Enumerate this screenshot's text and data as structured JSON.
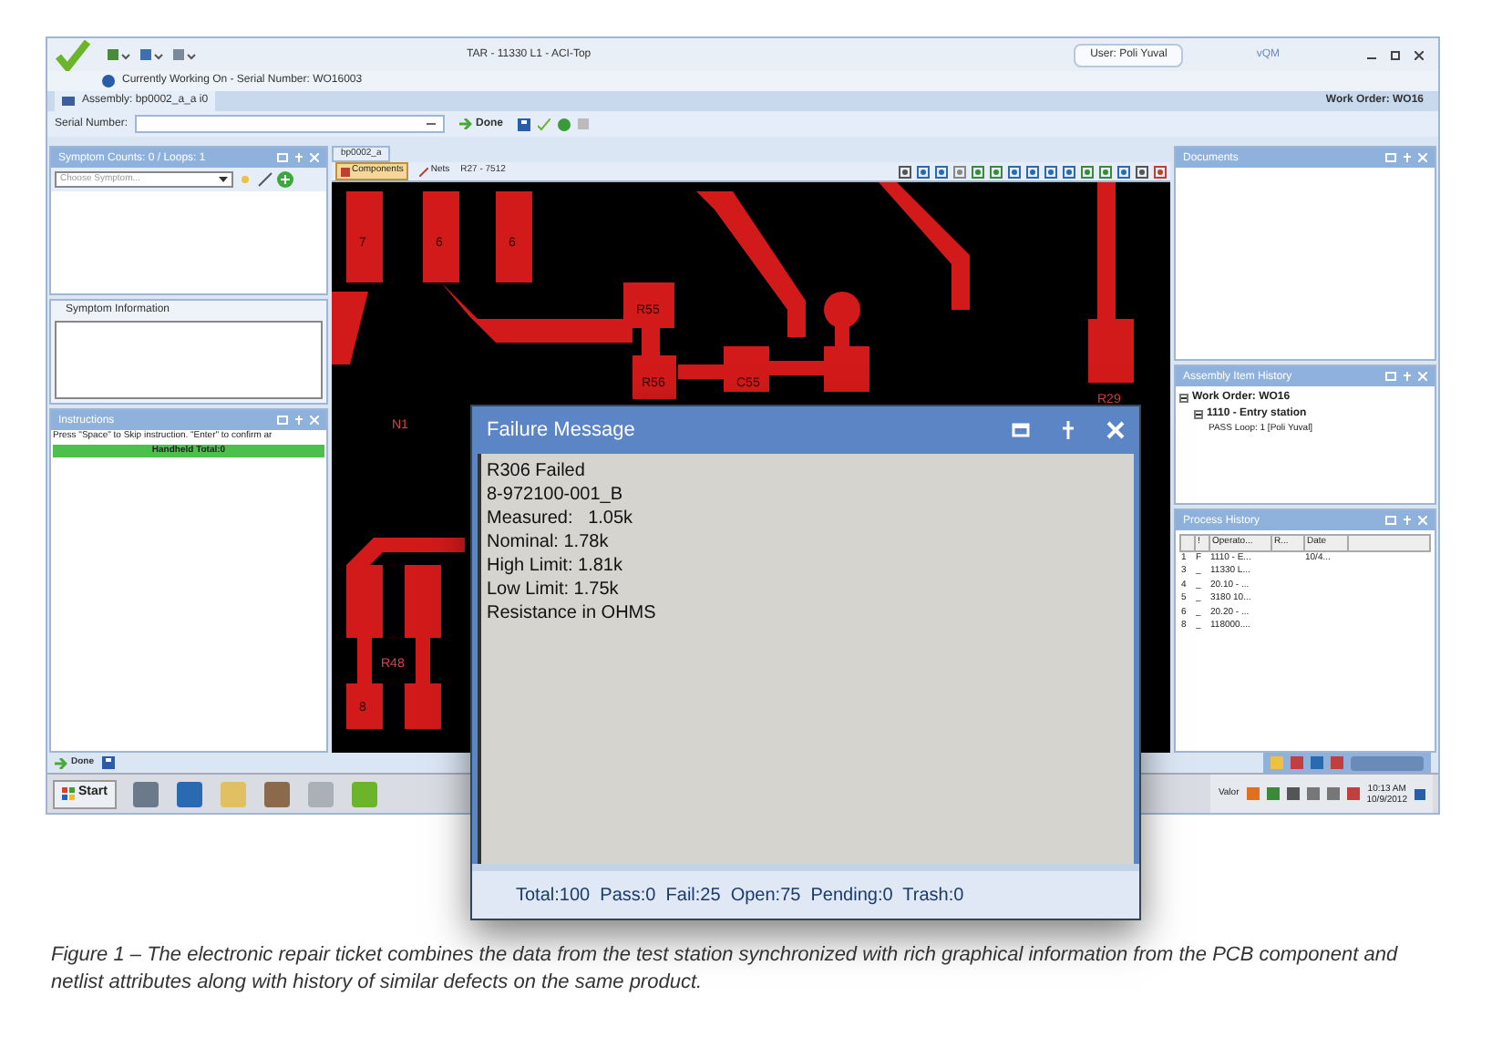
{
  "window": {
    "title": "TAR -  11330 L1 - ACI-Top",
    "user": "User: Poli Yuval",
    "app_name": "vQM"
  },
  "working_on": "Currently Working On - Serial Number: WO16003",
  "assembly_tab": "Assembly: bp0002_a_a i0",
  "work_order": "Work Order: WO16",
  "serial_number": {
    "label": "Serial Number:",
    "done": "Done"
  },
  "symptom_panel": {
    "title": "Symptom Counts: 0 / Loops: 1",
    "placeholder": "Choose Symptom..."
  },
  "symptom_info": {
    "title": "Symptom Information"
  },
  "instructions": {
    "title": "Instructions",
    "hint": "Press \"Space\" to Skip instruction. \"Enter\" to confirm ar",
    "progress": "Handheld Total:0"
  },
  "bottom_done": "Done",
  "board_view": {
    "tab": "bp0002_a",
    "tabs": [
      {
        "label": "Components",
        "selected": true
      },
      {
        "label": "Nets",
        "selected": false
      }
    ],
    "net": "R27 - 7512",
    "labels": [
      "7",
      "6",
      "6",
      "R55",
      "R56",
      "C55",
      "N1",
      "R29",
      "8",
      "R48"
    ]
  },
  "documents": {
    "title": "Documents"
  },
  "item_history": {
    "title": "Assembly Item History",
    "tree": [
      {
        "label": "Work Order: WO16",
        "children": [
          {
            "label": "1110 - Entry station",
            "children": [
              {
                "label": "PASS Loop: 1 [Poli Yuval]"
              }
            ]
          }
        ]
      }
    ]
  },
  "process_history": {
    "title": "Process History",
    "columns": [
      "",
      "!",
      "Operato...",
      "R...",
      "Date"
    ],
    "rows": [
      [
        "1",
        "F",
        "1110 - E...",
        "",
        "10/4..."
      ],
      [
        "3",
        "_",
        "11330 L...",
        "",
        ""
      ],
      [
        "4",
        "_",
        "20.10 - ...",
        "",
        ""
      ],
      [
        "5",
        "_",
        "3180 10...",
        "",
        ""
      ],
      [
        "6",
        "_",
        "20.20 - ...",
        "",
        ""
      ],
      [
        "8",
        "_",
        "118000....",
        "",
        ""
      ]
    ]
  },
  "taskbar": {
    "start": "Start",
    "tray_label": "Valor",
    "time": "10:13 AM",
    "date": "10/9/2012"
  },
  "failure_dialog": {
    "title": "Failure Message",
    "lines": [
      "R306 Failed",
      "8-972100-001_B",
      "Measured:   1.05k",
      "Nominal: 1.78k",
      "High Limit: 1.81k",
      "Low Limit: 1.75k",
      "Resistance in OHMS"
    ],
    "status": "Total:100  Pass:0  Fail:25  Open:75  Pending:0  Trash:0"
  },
  "caption": "Figure 1 – The electronic repair ticket combines the data from the test station synchronized with rich graphical information from the PCB component and netlist attributes along with history of similar defects on the same product."
}
